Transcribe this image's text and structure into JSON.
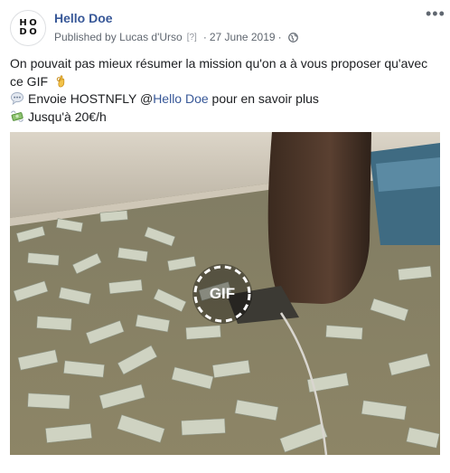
{
  "post": {
    "page_name": "Hello Doe",
    "avatar_letters": [
      "H",
      "O",
      "D",
      "O"
    ],
    "published_by_prefix": "Published by",
    "author": "Lucas d'Urso",
    "author_help": "[?]",
    "separator": "·",
    "date": "27 June 2019",
    "privacy_icon": "globe-icon",
    "more_icon": "more-options-icon",
    "more_symbol": "•••",
    "text_line1": "On pouvait pas mieux résumer la mission qu'on a à vous proposer qu'avec",
    "text_line2": "ce GIF",
    "emoji_1": "ok-hand-emoji",
    "emoji_2": "speech-bubble-emoji",
    "text_line3_before": "Envoie HOSTNFLY @",
    "mention": "Hello Doe",
    "text_line3_after": " pour en savoir plus",
    "emoji_3": "money-with-wings-emoji",
    "text_line4": "Jusqu'à 20€/h",
    "gif_label": "GIF"
  },
  "colors": {
    "link": "#385898",
    "meta": "#606770",
    "text": "#1c1e21"
  }
}
